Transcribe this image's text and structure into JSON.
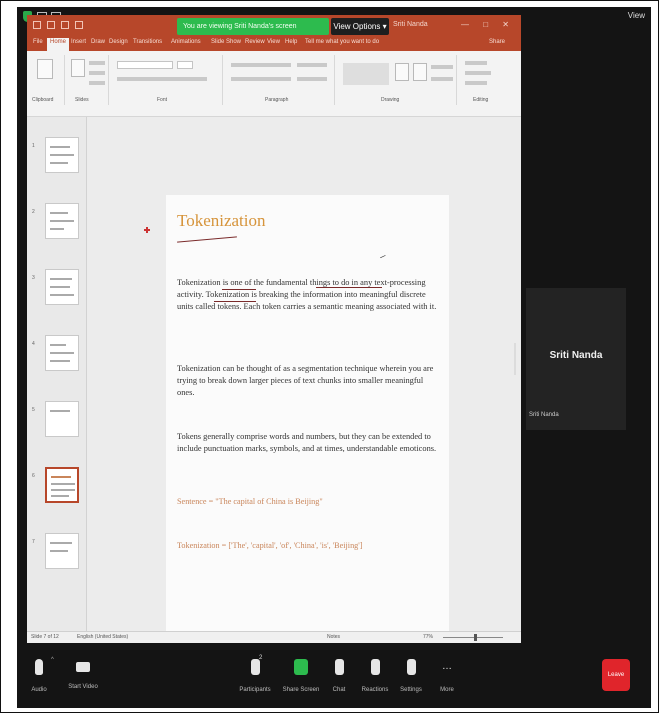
{
  "zoom": {
    "view_label": "View",
    "share_banner": "You are viewing Sriti Nanda's screen",
    "view_options": "View Options",
    "presenter_label": "Sriti Nanda",
    "participant": {
      "name": "Sriti Nanda",
      "tile_label": "Sriti Nanda"
    },
    "toolbar": {
      "audio": "Audio",
      "video": "Start Video",
      "participants": "Participants",
      "participants_count": "2",
      "share": "Share Screen",
      "chat": "Chat",
      "reactions": "Reactions",
      "settings": "Settings",
      "more": "More",
      "end": "Leave"
    }
  },
  "powerpoint": {
    "tabs": [
      "File",
      "Home",
      "Insert",
      "Draw",
      "Design",
      "Transitions",
      "Animations",
      "Slide Show",
      "Review",
      "View",
      "Help",
      "Tell me what you want to do"
    ],
    "share_tab": "Share",
    "ribbon_groups": [
      "Clipboard",
      "Slides",
      "Font",
      "Paragraph",
      "Drawing",
      "Editing"
    ],
    "slide_numbers": [
      "1",
      "2",
      "3",
      "4",
      "5",
      "6",
      "7"
    ],
    "status": {
      "slide_info": "Slide 7 of 12",
      "language": "English (United States)",
      "notes": "Notes",
      "zoom": "77%"
    },
    "slide": {
      "title": "Tokenization",
      "paragraphs": [
        "Tokenization is one of the fundamental things to do in any text-processing activity. Tokenization is breaking the information into meaningful discrete units called tokens. Each token carries a semantic meaning associated with it.",
        "Tokenization can be thought of as a segmentation technique wherein you are trying to break down larger pieces of text chunks into smaller meaningful ones.",
        "Tokens generally comprise words and numbers, but they can be extended to include punctuation marks, symbols, and at times, understandable emoticons."
      ],
      "examples": [
        "Sentence = \"The capital of China is Beijing\"",
        "Tokenization = ['The', 'capital', 'of', 'China', 'is', 'Beijing']"
      ]
    }
  }
}
